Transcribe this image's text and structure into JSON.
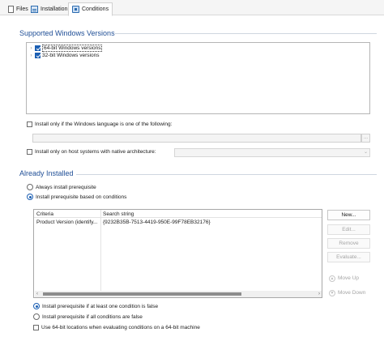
{
  "tabs": [
    {
      "label": "Files",
      "icon": "file-icon",
      "active": false
    },
    {
      "label": "Installation",
      "icon": "installation-icon",
      "active": false
    },
    {
      "label": "Conditions",
      "icon": "conditions-icon",
      "active": true
    }
  ],
  "supported_versions": {
    "title": "Supported Windows Versions",
    "items": [
      {
        "label": "64-bit Windows versions",
        "checked": true,
        "selected": true
      },
      {
        "label": "32-bit Windows versions",
        "checked": true,
        "selected": false
      }
    ],
    "language_option": {
      "label": "Install only if the Windows language is one of the following:",
      "checked": false,
      "value": "",
      "button_label": "..."
    },
    "architecture_option": {
      "label": "Install only on host systems with native architecture:",
      "checked": false,
      "value": ""
    }
  },
  "already_installed": {
    "title": "Already Installed",
    "always_option": {
      "label": "Always install prerequisite",
      "checked": false
    },
    "conditions_option": {
      "label": "Install prerequisite based on conditions",
      "checked": true
    },
    "table": {
      "columns": [
        "Criteria",
        "Search string"
      ],
      "rows": [
        {
          "criteria": "Product Version (identify...",
          "search": "{9232B35B-7513-4419-950E-99F78EB32176}"
        }
      ]
    },
    "buttons": {
      "new": "New...",
      "edit": "Edit...",
      "remove": "Remove",
      "evaluate": "Evaluate...",
      "move_up": "Move Up",
      "move_down": "Move Down"
    },
    "at_least_one_option": {
      "label": "Install prerequisite if at least one condition is false",
      "checked": true
    },
    "all_false_option": {
      "label": "Install prerequisite if all conditions are false",
      "checked": false
    },
    "use_64bit_option": {
      "label": "Use 64-bit locations when evaluating conditions on a 64-bit machine",
      "checked": false
    }
  },
  "colors": {
    "accent": "#1c5fb3",
    "section_title": "#1f4e96"
  }
}
